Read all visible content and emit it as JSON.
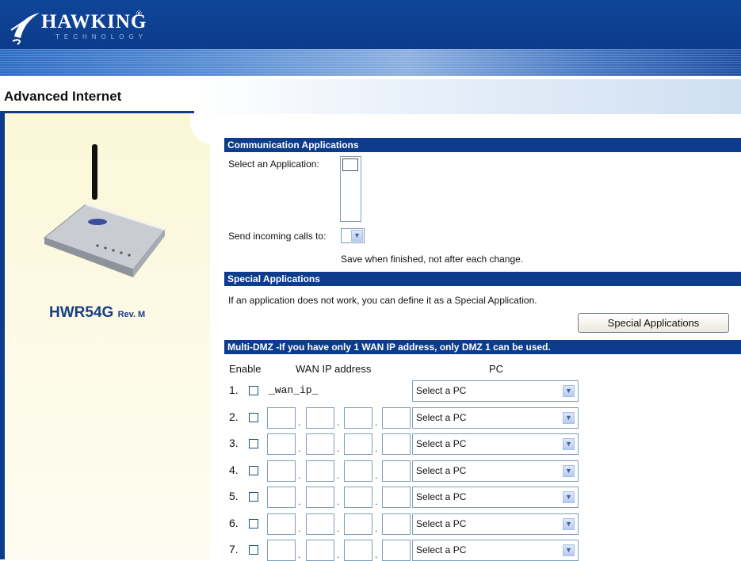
{
  "brand": {
    "name": "HAWKING",
    "sub": "TECHNOLOGY",
    "reg": "®"
  },
  "page_title": "Advanced Internet",
  "device": {
    "model": "HWR54G",
    "rev": "Rev. M"
  },
  "comm": {
    "header": "Communication Applications",
    "select_label": "Select an Application:",
    "send_label": "Send incoming calls to:",
    "save_note": "Save when finished, not after each change."
  },
  "special": {
    "header": "Special Applications",
    "desc": "If an application does not work, you can define it as a Special Application.",
    "button": "Special Applications"
  },
  "dmz": {
    "header": "Multi-DMZ -If you have only 1 WAN IP address, only DMZ 1 can be used.",
    "col_enable": "Enable",
    "col_wan": "WAN IP address",
    "col_pc": "PC",
    "rows": [
      {
        "num": "1.",
        "wan": "_wan_ip_",
        "pc": "Select a PC"
      },
      {
        "num": "2.",
        "wan": "",
        "pc": "Select a PC"
      },
      {
        "num": "3.",
        "wan": "",
        "pc": "Select a PC"
      },
      {
        "num": "4.",
        "wan": "",
        "pc": "Select a PC"
      },
      {
        "num": "5.",
        "wan": "",
        "pc": "Select a PC"
      },
      {
        "num": "6.",
        "wan": "",
        "pc": "Select a PC"
      },
      {
        "num": "7.",
        "wan": "",
        "pc": "Select a PC"
      }
    ]
  },
  "colors": {
    "brand_blue": "#0c3c8b",
    "panel": "#fbf7d8"
  }
}
